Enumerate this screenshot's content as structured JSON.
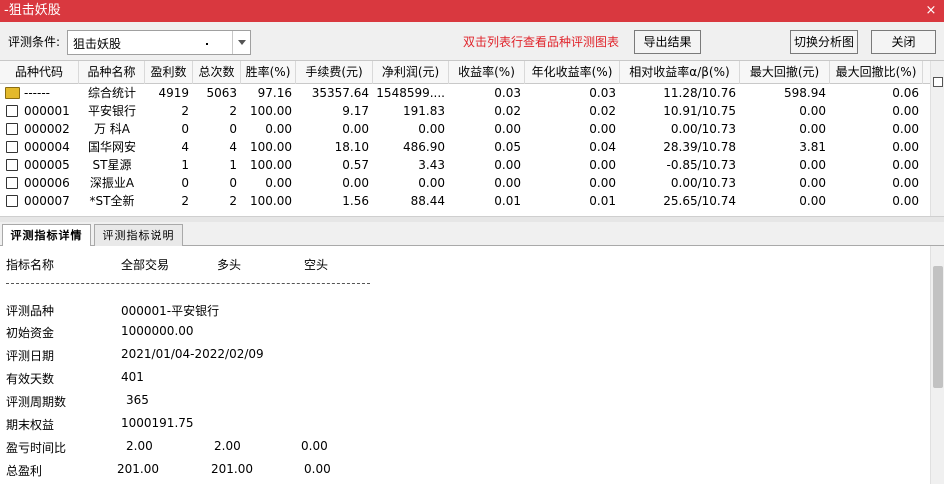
{
  "window": {
    "title": "-狙击妖股",
    "close_glyph": "×"
  },
  "toolbar": {
    "condition_label": "评测条件:",
    "condition_value": "狙击妖股",
    "hint": "双击列表行查看品种评测图表",
    "export_label": "导出结果",
    "switch_label": "切换分析图",
    "close_label": "关闭"
  },
  "table": {
    "columns": [
      "品种代码",
      "品种名称",
      "盈利数",
      "总次数",
      "胜率(%)",
      "手续费(元)",
      "净利润(元)",
      "收益率(%)",
      "年化收益率(%)",
      "相对收益率α/β(%)",
      "最大回撤(元)",
      "最大回撤比(%)"
    ],
    "rows": [
      {
        "icon": "folder-icon",
        "code": "------",
        "name": "综合统计",
        "wins": "4919",
        "total": "5063",
        "win_rate": "97.16",
        "fee": "35357.64",
        "net_profit": "1548599....",
        "return": "0.03",
        "annual_return": "0.03",
        "relative": "11.28/10.76",
        "max_dd": "598.94",
        "max_dd_ratio": "0.06"
      },
      {
        "icon": "document-icon",
        "code": "000001",
        "name": "平安银行",
        "wins": "2",
        "total": "2",
        "win_rate": "100.00",
        "fee": "9.17",
        "net_profit": "191.83",
        "return": "0.02",
        "annual_return": "0.02",
        "relative": "10.91/10.75",
        "max_dd": "0.00",
        "max_dd_ratio": "0.00"
      },
      {
        "icon": "document-icon",
        "code": "000002",
        "name": "万 科A",
        "wins": "0",
        "total": "0",
        "win_rate": "0.00",
        "fee": "0.00",
        "net_profit": "0.00",
        "return": "0.00",
        "annual_return": "0.00",
        "relative": "0.00/10.73",
        "max_dd": "0.00",
        "max_dd_ratio": "0.00"
      },
      {
        "icon": "document-icon",
        "code": "000004",
        "name": "国华网安",
        "wins": "4",
        "total": "4",
        "win_rate": "100.00",
        "fee": "18.10",
        "net_profit": "486.90",
        "return": "0.05",
        "annual_return": "0.04",
        "relative": "28.39/10.78",
        "max_dd": "3.81",
        "max_dd_ratio": "0.00"
      },
      {
        "icon": "document-icon",
        "code": "000005",
        "name": "ST星源",
        "wins": "1",
        "total": "1",
        "win_rate": "100.00",
        "fee": "0.57",
        "net_profit": "3.43",
        "return": "0.00",
        "annual_return": "0.00",
        "relative": "-0.85/10.73",
        "max_dd": "0.00",
        "max_dd_ratio": "0.00"
      },
      {
        "icon": "document-icon",
        "code": "000006",
        "name": "深振业A",
        "wins": "0",
        "total": "0",
        "win_rate": "0.00",
        "fee": "0.00",
        "net_profit": "0.00",
        "return": "0.00",
        "annual_return": "0.00",
        "relative": "0.00/10.73",
        "max_dd": "0.00",
        "max_dd_ratio": "0.00"
      },
      {
        "icon": "document-icon",
        "code": "000007",
        "name": "*ST全新",
        "wins": "2",
        "total": "2",
        "win_rate": "100.00",
        "fee": "1.56",
        "net_profit": "88.44",
        "return": "0.01",
        "annual_return": "0.01",
        "relative": "25.65/10.74",
        "max_dd": "0.00",
        "max_dd_ratio": "0.00"
      }
    ]
  },
  "tabs": [
    {
      "label": "评测指标详情",
      "active": true
    },
    {
      "label": "评测指标说明",
      "active": false
    }
  ],
  "detail": {
    "header": {
      "name": "指标名称",
      "all": "全部交易",
      "long": "多头",
      "short": "空头"
    },
    "separator": "--------------------------------------------------------------------------------",
    "items": [
      {
        "label": "评测品种",
        "value": "000001-平安银行"
      },
      {
        "label": "初始资金",
        "value": "1000000.00"
      },
      {
        "label": "评测日期",
        "value": "2021/01/04-2022/02/09"
      },
      {
        "label": "有效天数",
        "value": "401"
      },
      {
        "label": "评测周期数",
        "value": "365"
      },
      {
        "label": "期末权益",
        "value": "1000191.75"
      }
    ],
    "multi_items": [
      {
        "label": "盈亏时间比",
        "all": "2.00",
        "long": "2.00",
        "short": "0.00"
      },
      {
        "label": "总盈利",
        "all": "201.00",
        "long": "201.00",
        "short": "0.00"
      }
    ]
  }
}
